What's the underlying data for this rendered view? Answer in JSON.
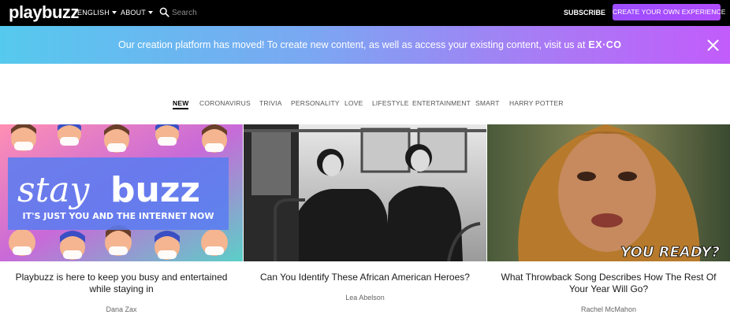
{
  "brand": {
    "logo": "playbuzz"
  },
  "nav": {
    "language": "ENGLISH",
    "about": "ABOUT",
    "search_placeholder": "Search",
    "subscribe": "SUBSCRIBE",
    "create": "CREATE YOUR OWN EXPERIENCE"
  },
  "banner": {
    "text": "Our creation platform has moved! To create new content, as well as access your existing content, visit us at",
    "exco": "EX·CO"
  },
  "tabs": [
    "NEW",
    "CORONAVIRUS",
    "TRIVIA",
    "PERSONALITY",
    "LOVE",
    "LIFESTYLE",
    "ENTERTAINMENT",
    "SMART",
    "HARRY POTTER"
  ],
  "active_tab": "NEW",
  "cards": [
    {
      "title": "Playbuzz is here to keep you busy and entertained while staying in",
      "author": "Dana Zax",
      "image_text": {
        "headline_a": "stay",
        "headline_b": "buzz",
        "subline": "IT'S JUST YOU AND THE INTERNET NOW"
      }
    },
    {
      "title": "Can You Identify These African American Heroes?",
      "author": "Lea Abelson"
    },
    {
      "title": "What Throwback Song Describes How The Rest Of Your Year Will Go?",
      "author": "Rachel McMahon",
      "image_text": {
        "caption": "YOU READY?"
      }
    }
  ],
  "colors": {
    "nav_bg": "#000000",
    "create_button": "#a24dff",
    "banner_start": "#56c9ee",
    "banner_end": "#c25cfb"
  },
  "icons": [
    "search-icon",
    "close-icon",
    "chevron-down-icon"
  ]
}
